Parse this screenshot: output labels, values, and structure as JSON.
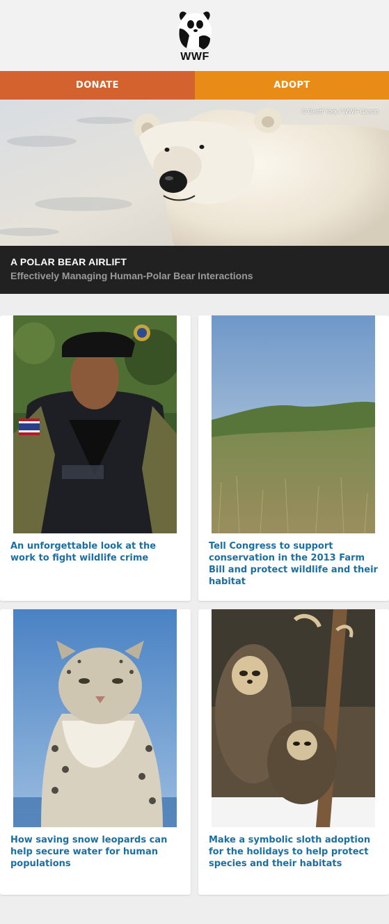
{
  "brand": {
    "logo_text": "WWF"
  },
  "nav": {
    "donate": "DONATE",
    "adopt": "ADOPT"
  },
  "hero": {
    "credit": "© Geoff York / WWF-Canon",
    "title": "A POLAR BEAR AIRLIFT",
    "subtitle": "Effectively Managing Human-Polar Bear Interactions"
  },
  "cards": [
    {
      "text": "An unforgettable look at the work to fight wildlife crime"
    },
    {
      "text": "Tell Congress to support conservation in the 2013 Farm Bill and protect wildlife and their habitat"
    },
    {
      "text": "How saving snow leopards can help secure water for human populations"
    },
    {
      "text": "Make a symbolic sloth adoption for the holidays to help protect species and their habitats"
    }
  ],
  "colors": {
    "donate": "#d4622f",
    "adopt": "#e88b17",
    "link": "#1a6fa3",
    "caption_bg": "#212121"
  }
}
